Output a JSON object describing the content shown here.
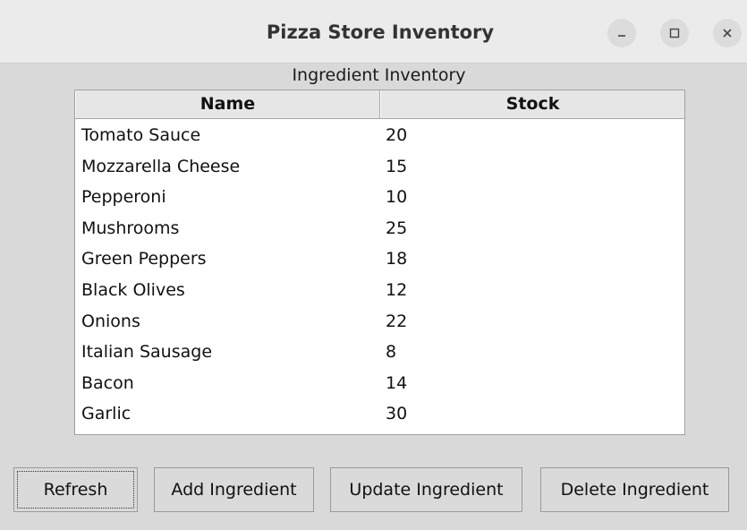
{
  "window": {
    "title": "Pizza Store Inventory",
    "controls": {
      "minimize": "–",
      "maximize": "□",
      "close": "×"
    }
  },
  "caption": "Ingredient Inventory",
  "table": {
    "columns": {
      "name": "Name",
      "stock": "Stock"
    },
    "rows": [
      {
        "name": "Tomato Sauce",
        "stock": "20"
      },
      {
        "name": "Mozzarella Cheese",
        "stock": "15"
      },
      {
        "name": "Pepperoni",
        "stock": "10"
      },
      {
        "name": "Mushrooms",
        "stock": "25"
      },
      {
        "name": "Green Peppers",
        "stock": "18"
      },
      {
        "name": "Black Olives",
        "stock": "12"
      },
      {
        "name": "Onions",
        "stock": "22"
      },
      {
        "name": "Italian Sausage",
        "stock": "8"
      },
      {
        "name": "Bacon",
        "stock": "14"
      },
      {
        "name": "Garlic",
        "stock": "30"
      }
    ]
  },
  "buttons": {
    "refresh": "Refresh",
    "add": "Add Ingredient",
    "update": "Update Ingredient",
    "delete": "Delete Ingredient"
  }
}
